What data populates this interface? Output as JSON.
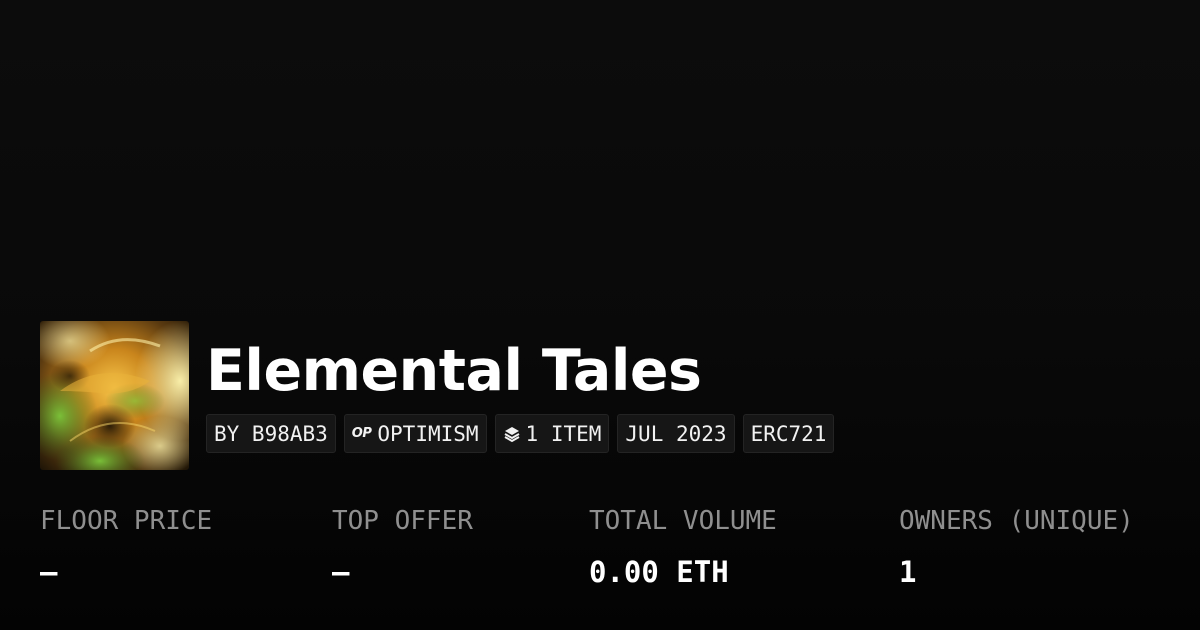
{
  "collection": {
    "title": "Elemental Tales",
    "badges": {
      "creator": "BY B98AB3",
      "chain_logo": "OP",
      "chain": "OPTIMISM",
      "items": "1 ITEM",
      "date": "JUL 2023",
      "standard": "ERC721"
    }
  },
  "stats": [
    {
      "label": "FLOOR PRICE",
      "value": "–"
    },
    {
      "label": "TOP OFFER",
      "value": "–"
    },
    {
      "label": "TOTAL VOLUME",
      "value": "0.00 ETH"
    },
    {
      "label": "OWNERS (UNIQUE)",
      "value": "1"
    }
  ],
  "icons": {
    "chain": "optimism-logo-icon",
    "items": "layers-icon"
  },
  "colors": {
    "background": "#0a0a0a",
    "badge_background": "#161616",
    "label_gray": "#8f8f8f",
    "text": "#ffffff"
  }
}
